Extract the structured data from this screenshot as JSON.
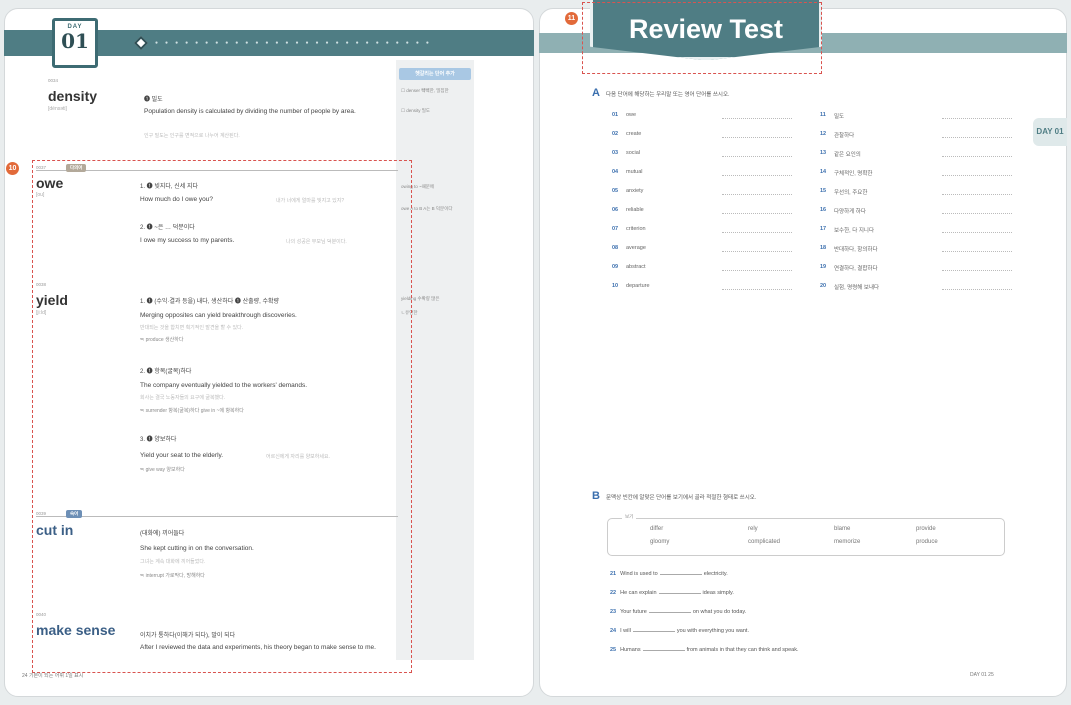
{
  "left": {
    "day_label": "DAY",
    "day_number": "01",
    "side_tag": "헷갈리는 단어 추가",
    "side_notes": [
      "☐ denser 빽빽한, 밀집한",
      "☐ density 밀도",
      "owing to ~때문에",
      "owe A to B A는 B 덕분이다",
      "yielding 수확량 많은",
      "ㄴ유연한"
    ],
    "entries": [
      {
        "num": "0034",
        "word": "density",
        "pron": "[dénsəti]",
        "def": "❶ 밀도",
        "example": "Population density is calculated by dividing the number of people by area.",
        "translation": "인구 밀도는 인구를 면적으로 나누어 계산된다."
      },
      {
        "num": "0037",
        "badge": "다의어",
        "word": "owe",
        "pron": "[ou]",
        "senses": [
          {
            "def": "1. ❶ 빚지다, 신세 지다",
            "example": "How much do I owe you?",
            "translation": "내가 너에게 얼마를 빚지고 있지?"
          },
          {
            "def": "2. ❶ ~은 … 덕분이다",
            "example": "I owe my success to my parents.",
            "translation": "나의 성공은 부모님 덕분이다."
          }
        ]
      },
      {
        "num": "0038",
        "word": "yield",
        "pron": "[jiːld]",
        "senses": [
          {
            "def": "1. ❶ (수익·결과 등을) 내다, 생산하다  ❶ 산출량, 수확량",
            "example": "Merging opposites can yield breakthrough discoveries.",
            "translation": "반대되는 것을 합치면 획기적인 발견을 할 수 있다.",
            "syn": "≒ produce 생산하다"
          },
          {
            "def": "2. ❶ 항복(굴복)하다",
            "example": "The company eventually yielded to the workers' demands.",
            "translation": "회사는 결국 노동자들의 요구에 굴복했다.",
            "syn": "≒ surrender 항복(굴복)하다   give in ~에 항복하다"
          },
          {
            "def": "3. ❶ 양보하다",
            "example": "Yield your seat to the elderly.",
            "translation": "어르신에게 자리를 양보하세요.",
            "syn": "≒ give way 양보하다"
          }
        ]
      },
      {
        "num": "0039",
        "badge": "숙어",
        "word": "cut in",
        "def": "(대화에) 끼어들다",
        "example": "She kept cutting in on the conversation.",
        "translation": "그녀는 계속 대화에 끼어들었다.",
        "syn": "≒ interrupt 가로막다, 방해하다"
      },
      {
        "num": "0040",
        "word": "make sense",
        "def": "이치가 통하다(이해가 되다), 말이 되다",
        "example": "After I reviewed the data and experiments, his theory began to make sense to me."
      }
    ],
    "footer": "24  기본이 되는 어휘 1일 표시",
    "callout_10": "10"
  },
  "right": {
    "title": "Review Test",
    "callout_11": "11",
    "side_tab": "DAY 01",
    "section_a": {
      "letter": "A",
      "instruction": "다음 단어에 해당하는 우리말 또는 영어 단어를 쓰시오.",
      "left_items": [
        {
          "num": "01",
          "text": "owe"
        },
        {
          "num": "02",
          "text": "create"
        },
        {
          "num": "03",
          "text": "social"
        },
        {
          "num": "04",
          "text": "mutual"
        },
        {
          "num": "05",
          "text": "anxiety"
        },
        {
          "num": "06",
          "text": "reliable"
        },
        {
          "num": "07",
          "text": "criterion"
        },
        {
          "num": "08",
          "text": "average"
        },
        {
          "num": "09",
          "text": "abstract"
        },
        {
          "num": "10",
          "text": "departure"
        }
      ],
      "right_items": [
        {
          "num": "11",
          "text": "밀도"
        },
        {
          "num": "12",
          "text": "관찰하다"
        },
        {
          "num": "13",
          "text": "같은 요인의"
        },
        {
          "num": "14",
          "text": "구체적인, 명확한"
        },
        {
          "num": "15",
          "text": "우선의, 주요한"
        },
        {
          "num": "16",
          "text": "다양하게 하다"
        },
        {
          "num": "17",
          "text": "보수한, 다 지니다"
        },
        {
          "num": "18",
          "text": "반대하다, 항의하다"
        },
        {
          "num": "19",
          "text": "연결하다, 결합하다"
        },
        {
          "num": "20",
          "text": "실험, 명령해 보내다"
        }
      ]
    },
    "section_b": {
      "letter": "B",
      "instruction": "문맥상 빈칸에 알맞은 단어를 보기에서 골라 적절한 형태로 쓰시오.",
      "wordbank_label": "보기",
      "words": [
        "differ",
        "rely",
        "blame",
        "provide",
        "gloomy",
        "complicated",
        "memorize",
        "produce"
      ],
      "sentences": [
        {
          "num": "21",
          "before": "Wind is used to",
          "after": "electricity."
        },
        {
          "num": "22",
          "before": "He can explain",
          "after": "ideas simply."
        },
        {
          "num": "23",
          "before": "Your future",
          "after": "on what you do today."
        },
        {
          "num": "24",
          "before": "I will",
          "after": "you with everything you want."
        },
        {
          "num": "25",
          "before": "Humans",
          "after": "from animals in that they can think and speak."
        }
      ]
    },
    "footer": "DAY 01  25"
  }
}
